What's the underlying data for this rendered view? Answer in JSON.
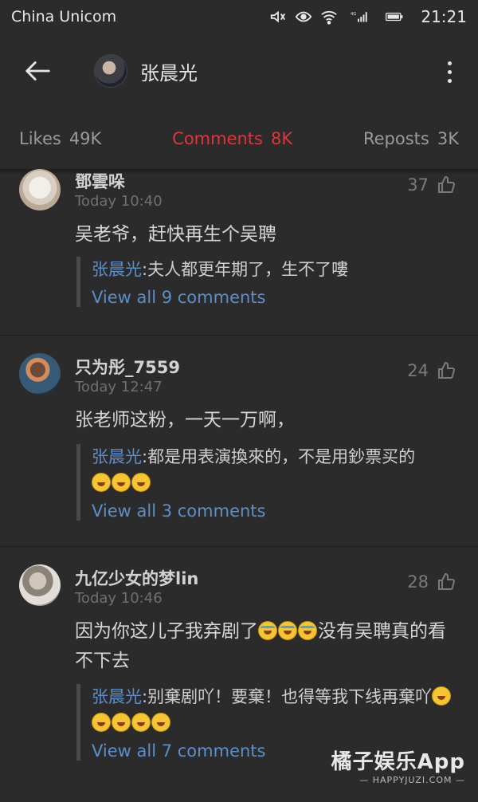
{
  "status": {
    "carrier": "China Unicom",
    "network": "4G",
    "time": "21:21"
  },
  "header": {
    "back_icon": "arrow-left-icon",
    "title": "张晨光",
    "menu_icon": "more-vertical-icon"
  },
  "tabs": [
    {
      "label": "Likes",
      "count": "49K"
    },
    {
      "label": "Comments",
      "count": "8K",
      "active": true
    },
    {
      "label": "Reposts",
      "count": "3K"
    }
  ],
  "comments": [
    {
      "user": "鄧雲哚",
      "time": "Today 10:40",
      "likes": "37",
      "text": "吴老爷，赶快再生个吴聘",
      "reply_author": "张晨光",
      "reply_text": "夫人都更年期了，生不了嘍",
      "view_all": "View all 9 comments"
    },
    {
      "user": "只为彤_7559",
      "time": "Today 12:47",
      "likes": "24",
      "text": "张老师这粉，一天一万啊，",
      "reply_author": "张晨光",
      "reply_text": "都是用表演換來的，不是用鈔票买的",
      "view_all": "View all 3 comments"
    },
    {
      "user": "九亿少女的梦lin",
      "time": "Today 10:46",
      "likes": "28",
      "text_a": "因为你这儿子我弃剧了",
      "text_b": "没有吴聘真的看不下去",
      "reply_author": "张晨光",
      "reply_text": "别棄剧吖！要棄！也得等我下线再棄吖",
      "view_all": "View all 7 comments"
    }
  ],
  "watermark": {
    "title": "橘子娱乐App",
    "subtitle": "— HAPPYJUZI.COM —"
  },
  "colors": {
    "accent": "#e0343b",
    "link": "#5b8fc9",
    "background": "#2b2b2b"
  }
}
